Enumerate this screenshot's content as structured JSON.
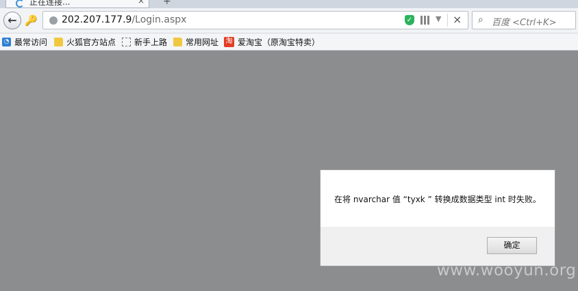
{
  "tab": {
    "title": "正在连接...",
    "close": "×",
    "new_tab": "+"
  },
  "nav": {
    "back": "←",
    "url_host": "202.207.177.9",
    "url_path": "/Login.aspx",
    "stop": "×"
  },
  "search": {
    "placeholder": "百度 <Ctrl+K>"
  },
  "bookmarks": [
    {
      "label": "最常访问",
      "icon": "most-visited-icon"
    },
    {
      "label": "火狐官方站点",
      "icon": "folder-icon"
    },
    {
      "label": "新手上路",
      "icon": "blank-page-icon"
    },
    {
      "label": "常用网址",
      "icon": "folder-icon"
    },
    {
      "label": "爱淘宝（原淘宝特卖）",
      "icon": "taobao-icon",
      "icon_text": "淘"
    }
  ],
  "dialog": {
    "message": "在将 nvarchar 值 “tyxk ” 转换成数据类型 int 时失败。",
    "ok_label": "确定"
  },
  "watermark": "www.wooyun.org",
  "colors": {
    "page_overlay": "#8c8d8f",
    "shield": "#2db35d",
    "taobao": "#e33d25"
  }
}
